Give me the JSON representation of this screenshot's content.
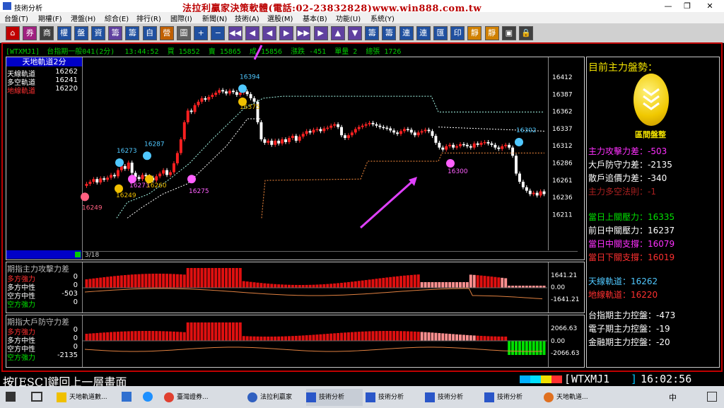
{
  "window": {
    "title": "技術分析",
    "banner": "法拉利贏家決策軟體(電話:02-23832828)www.win888.com.tw",
    "controls": [
      "—",
      "❐",
      "✕"
    ]
  },
  "menu": [
    "台盤(T)",
    "期權(F)",
    "港盤(H)",
    "綜合(E)",
    "排行(R)",
    "國際(I)",
    "新聞(N)",
    "技術(A)",
    "選股(M)",
    "基本(B)",
    "功能(U)",
    "系統(Y)"
  ],
  "toolbar": [
    "⌂",
    "券",
    "商",
    "權",
    "盤",
    "資",
    "籌",
    "籌",
    "自",
    "營",
    "圖",
    "+",
    "−",
    "◀◀",
    "◀",
    "◀",
    "▶",
    "▶▶",
    "▶",
    "▲",
    "▼",
    "籌",
    "籌",
    "連",
    "連",
    "匯",
    "印",
    "靜",
    "靜",
    "▣",
    "🔒"
  ],
  "status": {
    "symbol": "[WTXMJ1]",
    "name": "台指期一般041(2分)",
    "time": "13:44:52",
    "bid_label": "買",
    "bid": "15852",
    "ask_label": "賣",
    "ask": "15865",
    "last_label": "成",
    "last": "15856",
    "chg_label": "漲跌",
    "chg": "-451",
    "vol_label": "單量",
    "vol": "2",
    "total_label": "總張",
    "total": "1726"
  },
  "main": {
    "panel_title": "天地軌道2分",
    "legend": [
      {
        "label": "天線軌道",
        "value": "16262",
        "color": "#ffffff"
      },
      {
        "label": "多空軌道",
        "value": "16241",
        "color": "#ffffff"
      },
      {
        "label": "地線軌道",
        "value": "16220",
        "color": "#ff3030"
      }
    ],
    "y_ticks": [
      "16412",
      "16387",
      "16362",
      "16337",
      "16312",
      "16286",
      "16261",
      "16236",
      "16211"
    ],
    "markers": [
      {
        "label": "16394",
        "color": "#50c8ff"
      },
      {
        "label": "16375",
        "color": "#f0c000"
      },
      {
        "label": "16302",
        "color": "#50c8ff"
      },
      {
        "label": "16300",
        "color": "#ff60ff"
      },
      {
        "label": "16273",
        "color": "#50c8ff"
      },
      {
        "label": "16287",
        "color": "#50c8ff"
      },
      {
        "label": "16273",
        "color": "#ff60ff"
      },
      {
        "label": "16260",
        "color": "#f0c000"
      },
      {
        "label": "16249",
        "color": "#f0c000"
      },
      {
        "label": "16275",
        "color": "#ff60ff"
      },
      {
        "label": "16249",
        "color": "#ff60ff"
      }
    ],
    "page": "3/18"
  },
  "sub1": {
    "title": "期指主力攻擊力差",
    "rows": [
      {
        "label": "多方強力",
        "value": "0",
        "color": "#ff3030"
      },
      {
        "label": "多方中性",
        "value": "0",
        "color": "#ffffff"
      },
      {
        "label": "空方中性",
        "value": "-503",
        "color": "#ffffff"
      },
      {
        "label": "空方強力",
        "value": "0",
        "color": "#00e000"
      }
    ],
    "ticks": [
      "1641.21",
      "0.00",
      "-1641.21"
    ]
  },
  "sub2": {
    "title": "期指大戶防守力差",
    "rows": [
      {
        "label": "多方強力",
        "value": "0",
        "color": "#ff3030"
      },
      {
        "label": "多方中性",
        "value": "0",
        "color": "#ffffff"
      },
      {
        "label": "空方中性",
        "value": "0",
        "color": "#ffffff"
      },
      {
        "label": "空方強力",
        "value": "-2135",
        "color": "#00e000"
      }
    ],
    "ticks": [
      "2066.63",
      "0.00",
      "-2066.63"
    ]
  },
  "right": {
    "title": "目前主力盤勢：",
    "badge": "區間盤整",
    "items1": [
      {
        "label": "主力攻擊力差",
        "value": "-503",
        "color": "#ff30ff"
      },
      {
        "label": "大戶防守力差",
        "value": "-2135",
        "color": "#ffffff"
      },
      {
        "label": "散戶追價力差",
        "value": "-340",
        "color": "#ffffff"
      },
      {
        "label": "主力多空法則",
        "value": "-1",
        "color": "#aa2020"
      }
    ],
    "items2": [
      {
        "label": "當日上關壓力",
        "value": "16335",
        "color": "#00e000"
      },
      {
        "label": "前日中關壓力",
        "value": "16237",
        "color": "#ffffff"
      },
      {
        "label": "當日中關支撐",
        "value": "16079",
        "color": "#ff30ff"
      },
      {
        "label": "當日下關支撐",
        "value": "16019",
        "color": "#ff3030"
      }
    ],
    "items3": [
      {
        "label": "天線軌道",
        "value": "16262",
        "color": "#50c8ff"
      },
      {
        "label": "地線軌道",
        "value": "16220",
        "color": "#ff3030"
      }
    ],
    "items4": [
      {
        "label": "台指期主力控盤",
        "value": "-473",
        "color": "#ffffff"
      },
      {
        "label": "電子期主力控盤",
        "value": "-19",
        "color": "#ffffff"
      },
      {
        "label": "金融期主力控盤",
        "value": "-20",
        "color": "#ffffff"
      }
    ]
  },
  "bottom": {
    "hint": "按[ESC]鍵回上一層畫面",
    "symbol": "WTXMJ1",
    "clock": "16:02:56"
  },
  "taskbar": {
    "items": [
      "天地軌道數...",
      "臺灣證券...",
      "法拉利贏家",
      "技術分析",
      "技術分析",
      "技術分析",
      "技術分析",
      "天地軌道..."
    ],
    "tray": [
      "中"
    ]
  }
}
